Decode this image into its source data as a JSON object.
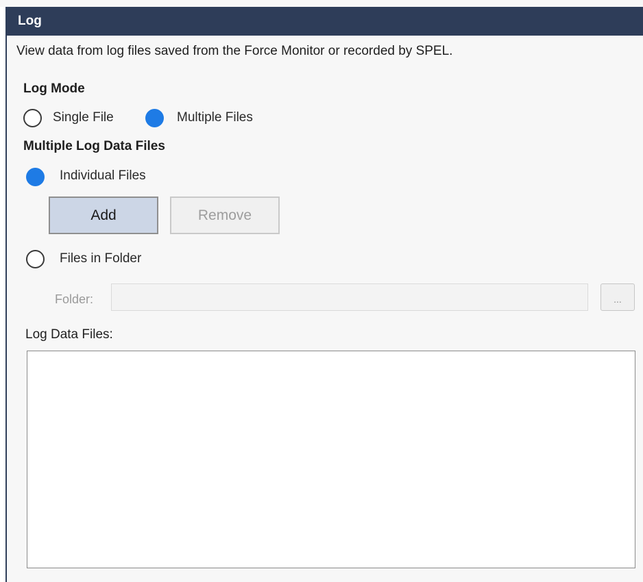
{
  "panel": {
    "title": "Log",
    "description": "View data from log files saved from the Force Monitor or recorded by SPEL."
  },
  "log_mode": {
    "title": "Log Mode",
    "options": [
      {
        "label": "Single File",
        "checked": false
      },
      {
        "label": "Multiple Files",
        "checked": true
      }
    ]
  },
  "multiple": {
    "title": "Multiple Log Data Files",
    "individual_label": "Individual Files",
    "individual_checked": true,
    "add_label": "Add",
    "remove_label": "Remove",
    "folder_option_label": "Files in Folder",
    "folder_option_checked": false,
    "folder_label": "Folder:",
    "folder_value": "",
    "browse_label": "..."
  },
  "files": {
    "label": "Log Data Files:",
    "items": []
  },
  "colors": {
    "titlebar": "#2e3d59",
    "radio_selected": "#1e7be5",
    "add_button": "#ccd6e6"
  },
  "icons": {
    "browse": "ellipsis-icon"
  }
}
